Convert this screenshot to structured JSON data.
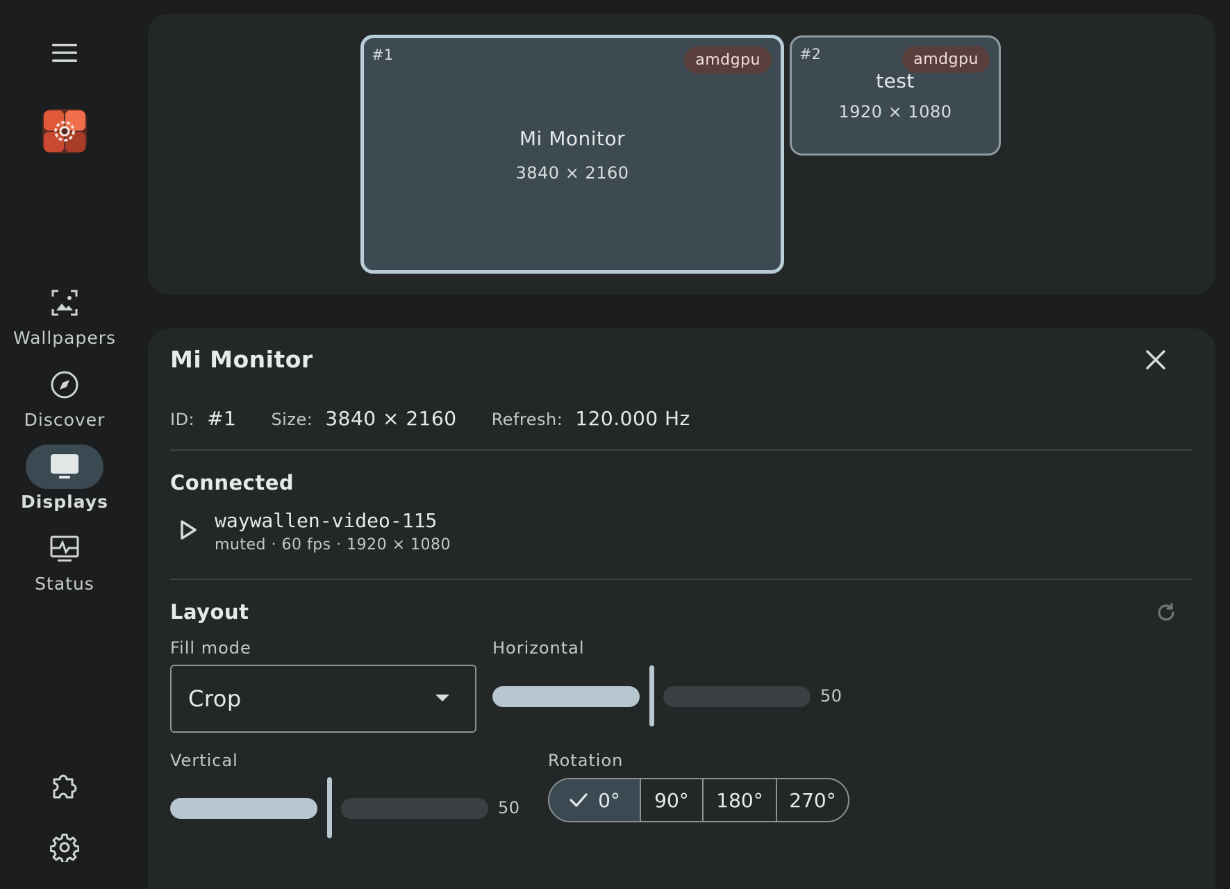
{
  "rail": {
    "items": [
      {
        "label": "Wallpapers",
        "icon": "wallpaper-icon",
        "active": false
      },
      {
        "label": "Discover",
        "icon": "compass-icon",
        "active": false
      },
      {
        "label": "Displays",
        "icon": "monitor-icon",
        "active": true
      },
      {
        "label": "Status",
        "icon": "status-monitor-icon",
        "active": false
      }
    ],
    "bottom": [
      "puzzle-icon",
      "gear-icon"
    ]
  },
  "preview": {
    "monitors": [
      {
        "id": "#1",
        "badge": "amdgpu",
        "name": "Mi Monitor",
        "resolution": "3840 × 2160",
        "selected": true
      },
      {
        "id": "#2",
        "badge": "amdgpu",
        "name": "test",
        "resolution": "1920 × 1080",
        "selected": false
      }
    ]
  },
  "detail": {
    "title": "Mi Monitor",
    "info": {
      "id_key": "ID:",
      "id_val": "#1",
      "size_key": "Size:",
      "size_val": "3840 × 2160",
      "refresh_key": "Refresh:",
      "refresh_val": "120.000 Hz"
    },
    "connected": {
      "title": "Connected",
      "name": "waywallen-video-115",
      "meta": "muted · 60 fps · 1920 × 1080"
    },
    "layout": {
      "title": "Layout",
      "fill_mode_label": "Fill mode",
      "fill_mode_value": "Crop",
      "horizontal_label": "Horizontal",
      "horizontal_value": "50",
      "vertical_label": "Vertical",
      "vertical_value": "50",
      "rotation_label": "Rotation",
      "rotation_options": [
        "0°",
        "90°",
        "180°",
        "270°"
      ],
      "rotation_selected": "0°"
    }
  },
  "colors": {
    "background": "#1b1d1e",
    "surface": "#242728",
    "monitor_fill": "#3d4a52",
    "selected_border": "#b9ced8",
    "badge": "#5a3e3c",
    "slider_active": "#b8c7cf"
  }
}
